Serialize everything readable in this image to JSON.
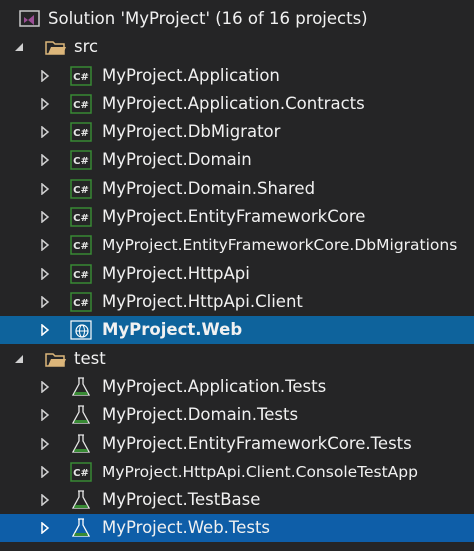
{
  "solution": {
    "label": "Solution 'MyProject' (16 of 16 projects)",
    "icon": "visual-studio-solution-icon"
  },
  "folders": [
    {
      "name": "src",
      "icon": "folder-open-icon"
    },
    {
      "name": "test",
      "icon": "folder-open-icon"
    }
  ],
  "projects": [
    {
      "label": "MyProject.Application",
      "icon": "csharp-project-icon"
    },
    {
      "label": "MyProject.Application.Contracts",
      "icon": "csharp-project-icon"
    },
    {
      "label": "MyProject.DbMigrator",
      "icon": "csharp-project-icon"
    },
    {
      "label": "MyProject.Domain",
      "icon": "csharp-project-icon"
    },
    {
      "label": "MyProject.Domain.Shared",
      "icon": "csharp-project-icon"
    },
    {
      "label": "MyProject.EntityFrameworkCore",
      "icon": "csharp-project-icon"
    },
    {
      "label": "MyProject.EntityFrameworkCore.DbMigrations",
      "icon": "csharp-project-icon"
    },
    {
      "label": "MyProject.HttpApi",
      "icon": "csharp-project-icon"
    },
    {
      "label": "MyProject.HttpApi.Client",
      "icon": "csharp-project-icon"
    },
    {
      "label": "MyProject.Web",
      "icon": "web-project-icon"
    },
    {
      "label": "MyProject.Application.Tests",
      "icon": "test-flask-icon"
    },
    {
      "label": "MyProject.Domain.Tests",
      "icon": "test-flask-icon"
    },
    {
      "label": "MyProject.EntityFrameworkCore.Tests",
      "icon": "test-flask-icon"
    },
    {
      "label": "MyProject.HttpApi.Client.ConsoleTestApp",
      "icon": "csharp-project-icon"
    },
    {
      "label": "MyProject.TestBase",
      "icon": "test-flask-icon"
    },
    {
      "label": "MyProject.Web.Tests",
      "icon": "test-flask-icon"
    }
  ],
  "colors": {
    "background": "#252526",
    "selection": "#0e639c",
    "text": "#f1f1f1",
    "csharp_icon": "#388a34",
    "folder_icon": "#dcb67a",
    "solution_icon": "#9b4f96"
  }
}
